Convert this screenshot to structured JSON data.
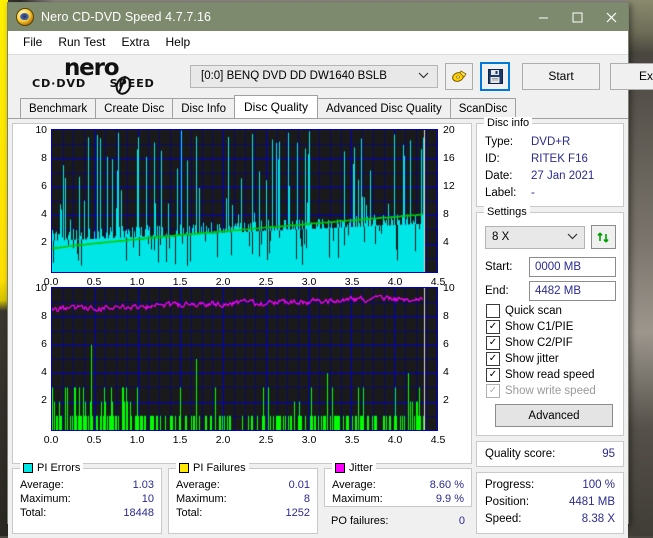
{
  "window": {
    "title": "Nero CD-DVD Speed 4.7.7.16",
    "icon": "nero-disc-icon",
    "minimize": "minimize-icon",
    "maximize": "maximize-icon",
    "close": "close-icon"
  },
  "menu": {
    "items": [
      {
        "label": "File"
      },
      {
        "label": "Run Test"
      },
      {
        "label": "Extra"
      },
      {
        "label": "Help"
      }
    ]
  },
  "toolbar": {
    "logo_word": "nero",
    "logo_sub_left": "CD·DVD",
    "logo_sub_right": "SPEED",
    "drive": "[0:0]   BENQ DVD DD DW1640 BSLB",
    "eject_icon": "eject-disc-icon",
    "save_icon": "save-floppy-icon",
    "start_label": "Start",
    "exit_label": "Exit"
  },
  "tabs": [
    {
      "label": "Benchmark",
      "active": false
    },
    {
      "label": "Create Disc",
      "active": false
    },
    {
      "label": "Disc Info",
      "active": false
    },
    {
      "label": "Disc Quality",
      "active": true
    },
    {
      "label": "Advanced Disc Quality",
      "active": false
    },
    {
      "label": "ScanDisc",
      "active": false
    }
  ],
  "disc_info": {
    "legend": "Disc info",
    "rows": [
      {
        "key": "Type:",
        "value": "DVD+R"
      },
      {
        "key": "ID:",
        "value": "RITEK F16"
      },
      {
        "key": "Date:",
        "value": "27 Jan 2021"
      },
      {
        "key": "Label:",
        "value": "-"
      }
    ]
  },
  "settings": {
    "legend": "Settings",
    "speed": "8 X",
    "refresh_icon": "refresh-icon",
    "start_label": "Start:",
    "start_value": "0000 MB",
    "end_label": "End:",
    "end_value": "4482 MB",
    "checks": [
      {
        "label": "Quick scan",
        "checked": false,
        "disabled": false
      },
      {
        "label": "Show C1/PIE",
        "checked": true,
        "disabled": false
      },
      {
        "label": "Show C2/PIF",
        "checked": true,
        "disabled": false
      },
      {
        "label": "Show jitter",
        "checked": true,
        "disabled": false
      },
      {
        "label": "Show read speed",
        "checked": true,
        "disabled": false
      },
      {
        "label": "Show write speed",
        "checked": true,
        "disabled": true
      }
    ],
    "advanced_label": "Advanced"
  },
  "quality": {
    "label": "Quality score:",
    "value": "95"
  },
  "progress": {
    "rows": [
      {
        "key": "Progress:",
        "value": "100 %"
      },
      {
        "key": "Position:",
        "value": "4481 MB"
      },
      {
        "key": "Speed:",
        "value": "8.38 X"
      }
    ]
  },
  "stats": {
    "pi_errors": {
      "legend": "PI Errors",
      "color": "#00e5e5",
      "rows": [
        {
          "key": "Average:",
          "value": "1.03"
        },
        {
          "key": "Maximum:",
          "value": "10"
        },
        {
          "key": "Total:",
          "value": "18448"
        }
      ]
    },
    "pi_failures": {
      "legend": "PI Failures",
      "color": "#ffe800",
      "rows": [
        {
          "key": "Average:",
          "value": "0.01"
        },
        {
          "key": "Maximum:",
          "value": "8"
        },
        {
          "key": "Total:",
          "value": "1252"
        }
      ]
    },
    "jitter": {
      "legend": "Jitter",
      "color": "#ff00ff",
      "rows": [
        {
          "key": "Average:",
          "value": "8.60 %"
        },
        {
          "key": "Maximum:",
          "value": "9.9 %"
        }
      ]
    },
    "po_failures": {
      "key": "PO failures:",
      "value": "0"
    }
  },
  "chart_data": [
    {
      "type": "area",
      "name": "pi-errors-chart",
      "title": "",
      "xlabel": "",
      "ylabel": "",
      "xlim": [
        0.0,
        4.5
      ],
      "x_ticks": [
        "0.0",
        "0.5",
        "1.0",
        "1.5",
        "2.0",
        "2.5",
        "3.0",
        "3.5",
        "4.0",
        "4.5"
      ],
      "ylim_left": [
        0,
        10
      ],
      "y_ticks_left": [
        "2",
        "4",
        "6",
        "8",
        "10"
      ],
      "ylim_right": [
        0,
        20
      ],
      "y_ticks_right": [
        "4",
        "8",
        "12",
        "16",
        "20"
      ],
      "grid": true,
      "grid_color": "#0000cc",
      "bg_color": "#1a1a1a",
      "series": [
        {
          "name": "PI Errors",
          "color": "#00e5e5",
          "kind": "bar-fill",
          "baseline_start": 2.2,
          "baseline_end": 3.4,
          "spike_max": 10,
          "points": 450
        },
        {
          "name": "Read speed",
          "color": "#00cc00",
          "kind": "line",
          "axis": "right",
          "start": 3.3,
          "end": 8.1
        }
      ]
    },
    {
      "type": "bar",
      "name": "pi-failures-jitter-chart",
      "title": "",
      "xlabel": "",
      "ylabel": "",
      "xlim": [
        0.0,
        4.5
      ],
      "x_ticks": [
        "0.0",
        "0.5",
        "1.0",
        "1.5",
        "2.0",
        "2.5",
        "3.0",
        "3.5",
        "4.0",
        "4.5"
      ],
      "ylim_left": [
        0,
        10
      ],
      "y_ticks_left": [
        "2",
        "4",
        "6",
        "8",
        "10"
      ],
      "ylim_right": [
        0,
        10
      ],
      "y_ticks_right": [
        "2",
        "4",
        "6",
        "8",
        "10"
      ],
      "grid": true,
      "grid_color": "#0000cc",
      "bg_color": "#1a1a1a",
      "series": [
        {
          "name": "PI Failures",
          "color": "#00ff00",
          "kind": "bar",
          "typical": 1,
          "spike_max": 8,
          "points": 450
        },
        {
          "name": "Jitter",
          "color": "#ff00ff",
          "kind": "line",
          "axis": "right",
          "start": 8.5,
          "end": 9.3,
          "noise": 0.35
        }
      ]
    }
  ]
}
